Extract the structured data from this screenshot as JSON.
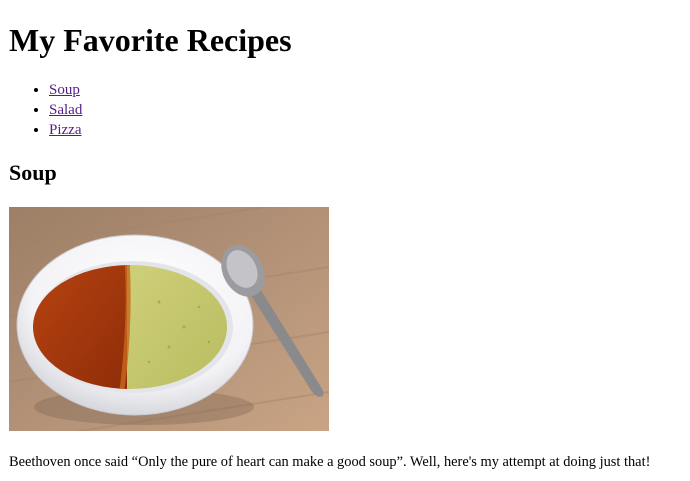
{
  "page": {
    "title": "My Favorite Recipes"
  },
  "nav": {
    "links": [
      {
        "label": "Soup"
      },
      {
        "label": "Salad"
      },
      {
        "label": "Pizza"
      }
    ]
  },
  "section": {
    "heading": "Soup",
    "image": {
      "alt": "Soup"
    },
    "description": "Beethoven once said “Only the pure of heart can make a good soup”. Well, here's my attempt at doing just that!"
  },
  "colors": {
    "link": "#551a8b",
    "text": "#000000",
    "background": "#ffffff"
  }
}
